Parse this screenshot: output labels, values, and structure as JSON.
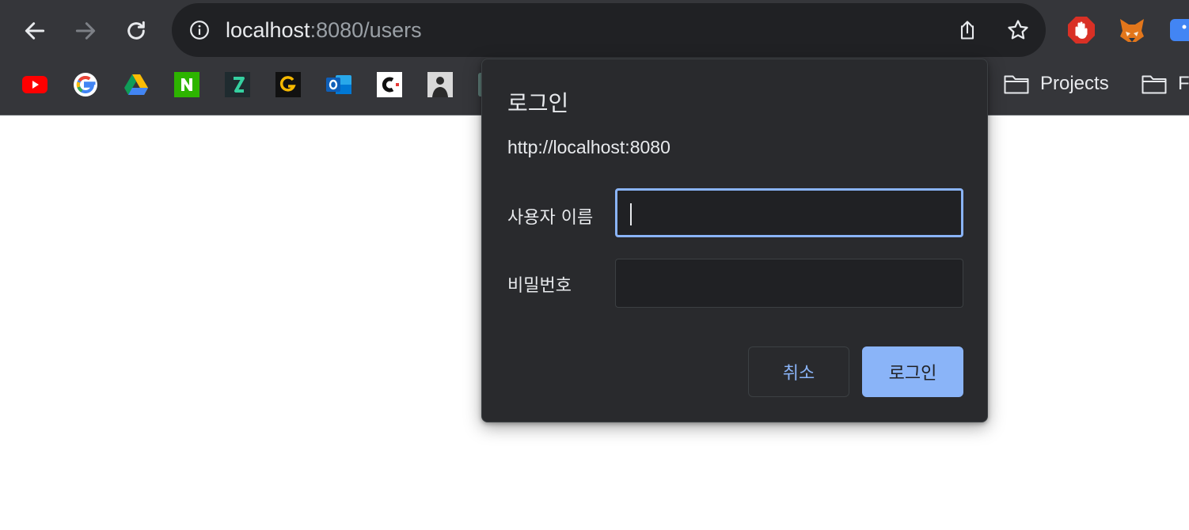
{
  "browser": {
    "url_host": "localhost",
    "url_rest": ":8080/users",
    "bookmarks_folders": [
      "Projects",
      "F"
    ]
  },
  "dialog": {
    "title": "로그인",
    "origin": "http://localhost:8080",
    "username_label": "사용자 이름",
    "username_value": "",
    "password_label": "비밀번호",
    "password_value": "",
    "cancel_label": "취소",
    "login_label": "로그인"
  },
  "colors": {
    "chrome_bg": "#35363a",
    "omnibox_bg": "#202124",
    "dialog_bg": "#292a2d",
    "accent": "#8ab4f8",
    "page_bg": "#ffffff"
  },
  "icons": {
    "nav": [
      "back-arrow-icon",
      "forward-arrow-icon",
      "reload-icon"
    ],
    "omnibox": [
      "info-icon",
      "share-icon",
      "bookmark-star-icon"
    ],
    "extensions": [
      "stop-hand-extension-icon",
      "fox-extension-icon",
      "blue-extension-icon"
    ],
    "bookmarks": [
      "youtube-icon",
      "google-icon",
      "google-drive-icon",
      "n-app-icon",
      "z-app-icon",
      "g-app-icon",
      "outlook-icon",
      "c-app-icon",
      "profile-photo-icon",
      "folder-icon"
    ]
  }
}
